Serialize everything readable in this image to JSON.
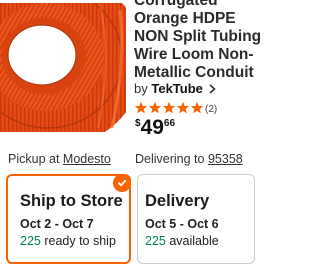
{
  "product": {
    "title_lines": [
      "Corrugated",
      "Orange HDPE",
      "NON Split Tubing",
      "Wire Loom Non-",
      "Metallic Conduit"
    ],
    "brand_prefix": "by",
    "brand_name": "TekTube",
    "rating": 5,
    "rating_count": "(2)",
    "price_currency": "$",
    "price_dollars": "49",
    "price_cents": "66"
  },
  "fulfillment": {
    "pickup_label": "Pickup at",
    "pickup_store": "Modesto",
    "delivering_label": "Delivering to",
    "delivering_zip": "95358"
  },
  "ship_card": {
    "title": "Ship to Store",
    "dates": "Oct 2 - Oct 7",
    "stock_count": "225",
    "stock_label": "ready to ship",
    "selected": true
  },
  "delivery_card": {
    "title": "Delivery",
    "dates": "Oct 5 - Oct 6",
    "stock_count": "225",
    "stock_label": "available"
  },
  "colors": {
    "accent": "#f96302",
    "stock_green": "#00805a",
    "product": "#e84a14"
  },
  "icons": {
    "check": "check-icon",
    "chevron": "chevron-right-icon",
    "star": "star-icon"
  }
}
